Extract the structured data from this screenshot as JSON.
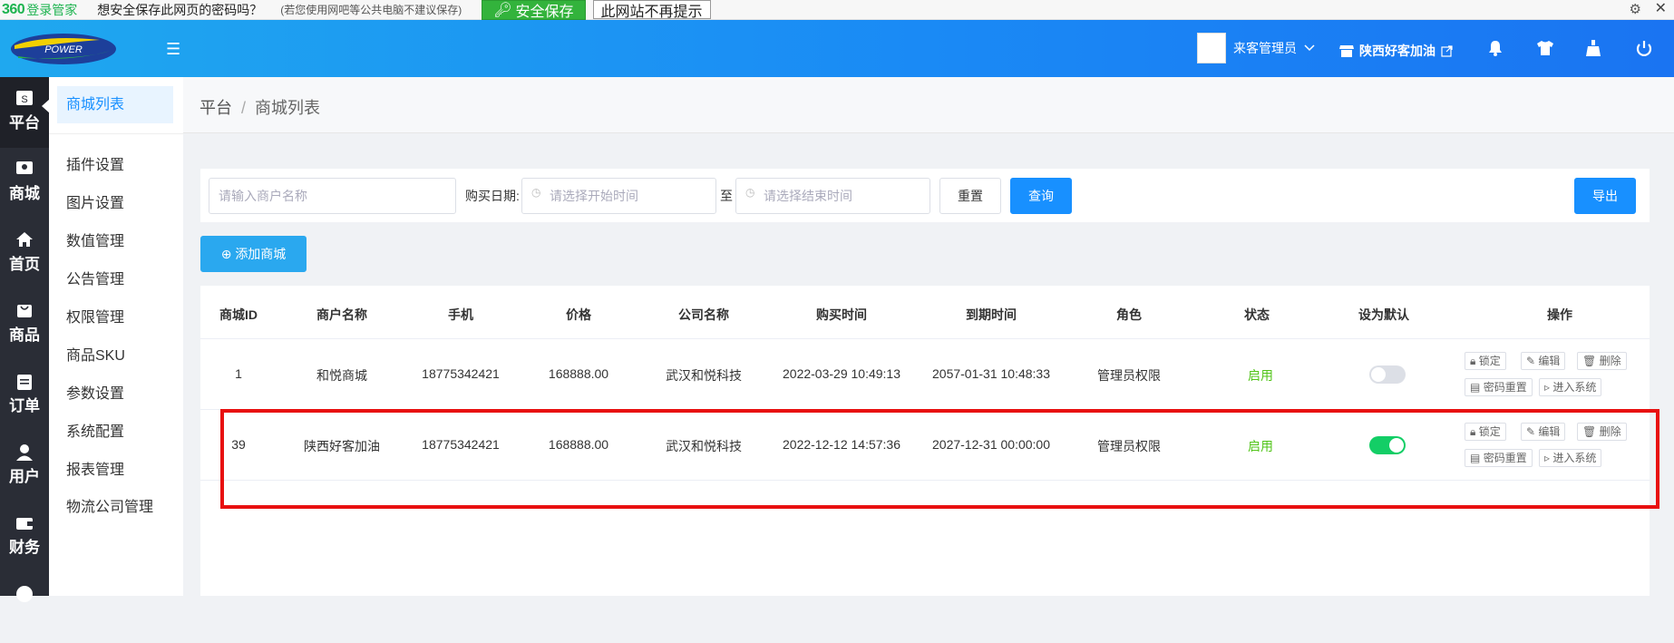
{
  "pwbar": {
    "logo": "360",
    "logo_text": "登录管家",
    "question": "想安全保存此网页的密码吗？",
    "hint": "(若您使用网吧等公共电脑不建议保存)",
    "save_label": "安全保存",
    "never_label": "此网站不再提示"
  },
  "header": {
    "user_name": "来客管理员",
    "shop_name": "陕西好客加油"
  },
  "rail": {
    "items": [
      {
        "label": "平台"
      },
      {
        "label": "商城"
      },
      {
        "label": "首页"
      },
      {
        "label": "商品"
      },
      {
        "label": "订单"
      },
      {
        "label": "用户"
      },
      {
        "label": "财务"
      }
    ]
  },
  "submenu": {
    "active": "商城列表",
    "items": [
      "插件设置",
      "图片设置",
      "数值管理",
      "公告管理",
      "权限管理",
      "商品SKU",
      "参数设置",
      "系统配置",
      "报表管理",
      "物流公司管理"
    ]
  },
  "breadcrumb": {
    "root": "平台",
    "sep": "/",
    "current": "商城列表"
  },
  "filter": {
    "merchant_placeholder": "请输入商户名称",
    "date_label": "购买日期:",
    "start_placeholder": "请选择开始时间",
    "to_label": "至",
    "end_placeholder": "请选择结束时间",
    "reset_label": "重置",
    "query_label": "查询",
    "export_label": "导出"
  },
  "add_label": "添加商城",
  "table": {
    "headers": [
      "商城ID",
      "商户名称",
      "手机",
      "价格",
      "公司名称",
      "购买时间",
      "到期时间",
      "角色",
      "状态",
      "设为默认",
      "操作"
    ],
    "rows": [
      {
        "id": "1",
        "merchant": "和悦商城",
        "phone": "18775342421",
        "price": "168888.00",
        "company": "武汉和悦科技",
        "buy_time": "2022-03-29 10:49:13",
        "expire_time": "2057-01-31 10:48:33",
        "role": "管理员权限",
        "status": "启用",
        "is_default": false
      },
      {
        "id": "39",
        "merchant": "陕西好客加油",
        "phone": "18775342421",
        "price": "168888.00",
        "company": "武汉和悦科技",
        "buy_time": "2022-12-12 14:57:36",
        "expire_time": "2027-12-31 00:00:00",
        "role": "管理员权限",
        "status": "启用",
        "is_default": true
      }
    ],
    "ops": {
      "lock": "锁定",
      "edit": "编辑",
      "delete": "删除",
      "reset_pwd": "密码重置",
      "enter": "进入系统"
    }
  },
  "colors": {
    "primary": "#1890ff",
    "header_start": "#1fa8ef",
    "header_end": "#1a74f2",
    "status_green": "#52c41a",
    "switch_on": "#13ce66",
    "highlight": "#e81010"
  }
}
